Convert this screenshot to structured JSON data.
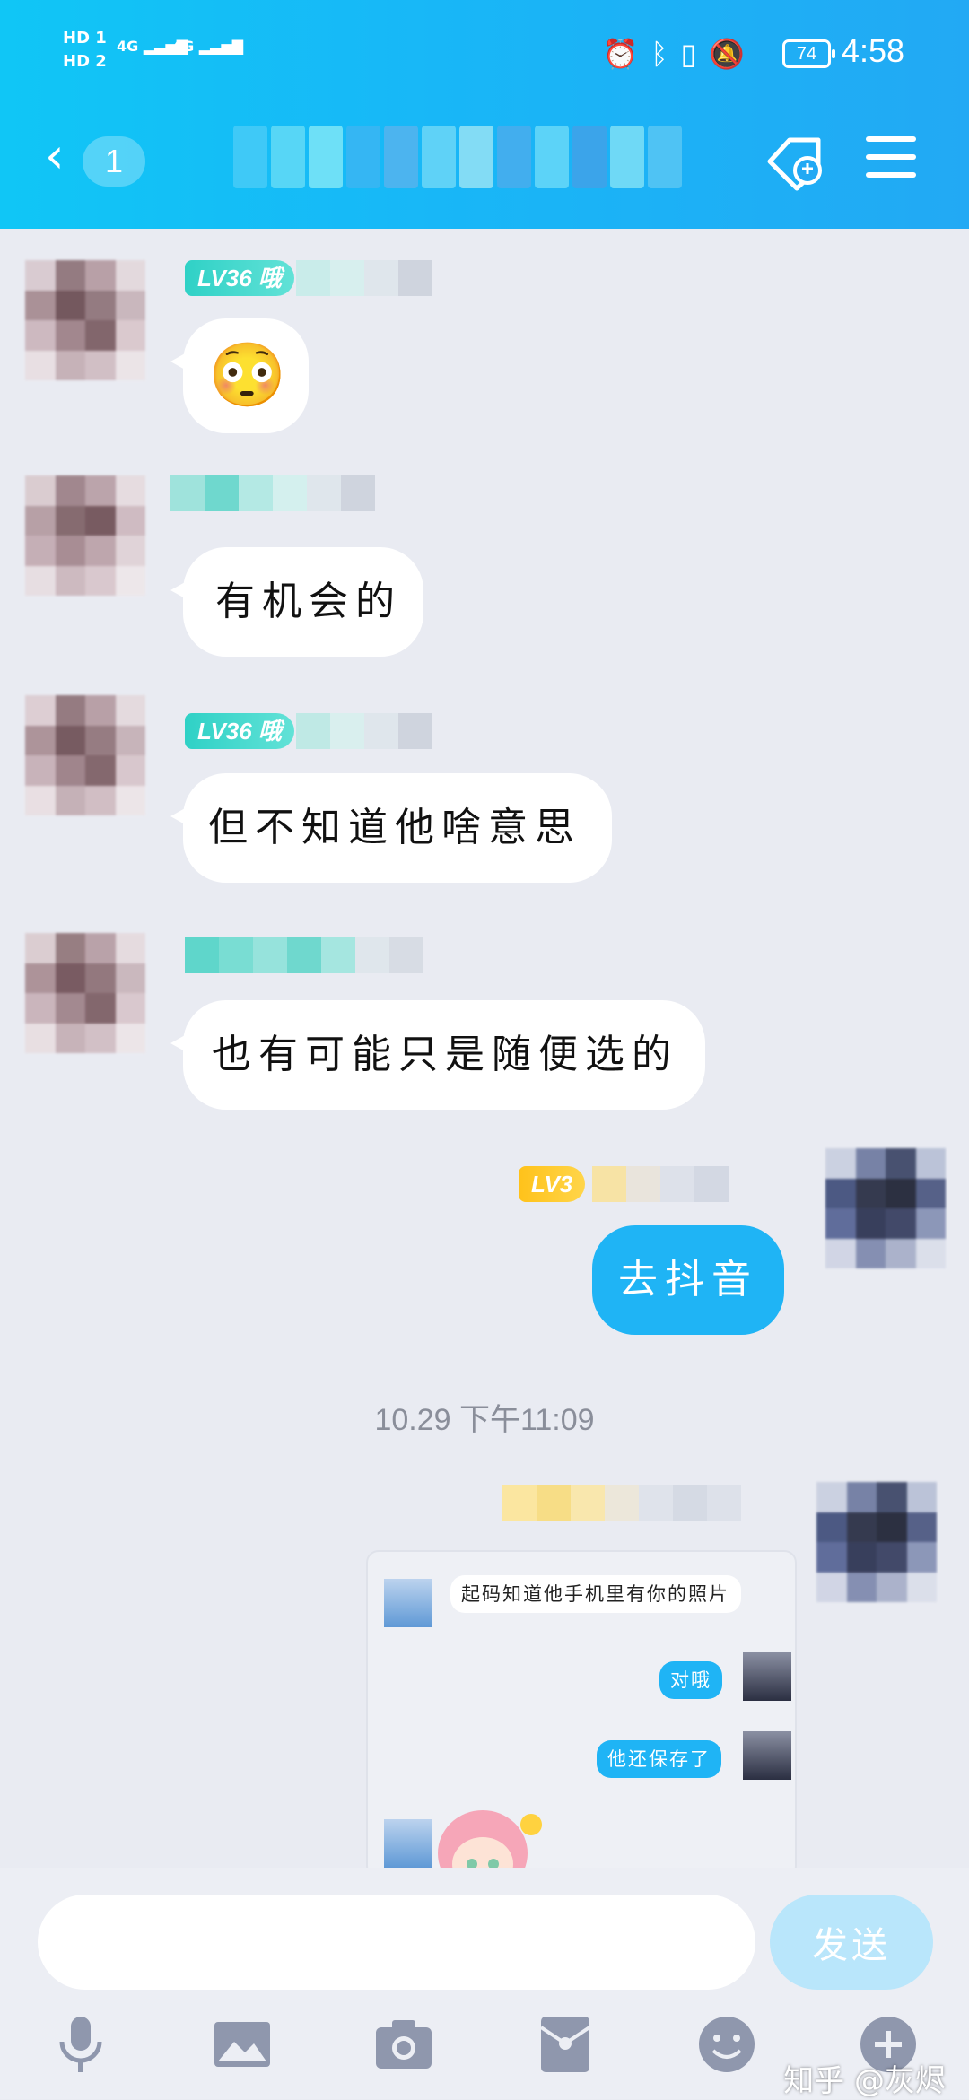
{
  "status_bar": {
    "hd1": "HD 1",
    "hd2": "HD 2",
    "sim1": "4G",
    "sim2": "4G",
    "battery": "74",
    "time": "4:58"
  },
  "header": {
    "back_count": "1",
    "accent": "#18b7f7"
  },
  "messages": [
    {
      "side": "left",
      "level": "LV36 哦",
      "emoji": "😳"
    },
    {
      "side": "left",
      "text": "有机会的"
    },
    {
      "side": "left",
      "level": "LV36 哦",
      "text": "但不知道他啥意思"
    },
    {
      "side": "left",
      "text": "也有可能只是随便选的"
    },
    {
      "side": "right",
      "level": "LV3",
      "text": "去抖音"
    }
  ],
  "timestamp": "10.29 下午11:09",
  "forward_card": {
    "msg1": "起码知道他手机里有你的照片",
    "msg2": "对哦",
    "msg3": "他还保存了"
  },
  "input": {
    "placeholder": "",
    "send_label": "发送"
  },
  "watermark": "知乎 @灰烬"
}
